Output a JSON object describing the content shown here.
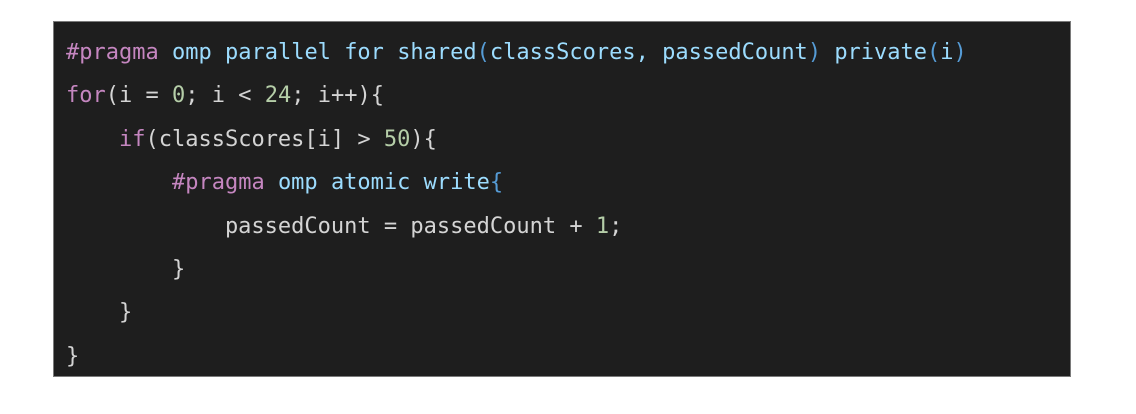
{
  "code": {
    "lines": [
      [
        {
          "t": "#pragma",
          "c": "dir"
        },
        {
          "t": " ",
          "c": "pl"
        },
        {
          "t": "omp",
          "c": "id"
        },
        {
          "t": " ",
          "c": "pl"
        },
        {
          "t": "parallel",
          "c": "id"
        },
        {
          "t": " ",
          "c": "pl"
        },
        {
          "t": "for",
          "c": "id"
        },
        {
          "t": " ",
          "c": "pl"
        },
        {
          "t": "shared",
          "c": "id"
        },
        {
          "t": "(",
          "c": "br"
        },
        {
          "t": "classScores, passedCount",
          "c": "id"
        },
        {
          "t": ")",
          "c": "br"
        },
        {
          "t": " ",
          "c": "pl"
        },
        {
          "t": "private",
          "c": "id"
        },
        {
          "t": "(",
          "c": "br"
        },
        {
          "t": "i",
          "c": "id"
        },
        {
          "t": ")",
          "c": "br"
        }
      ],
      [
        {
          "t": "for",
          "c": "kw"
        },
        {
          "t": "(i = ",
          "c": "pl"
        },
        {
          "t": "0",
          "c": "num"
        },
        {
          "t": "; i < ",
          "c": "pl"
        },
        {
          "t": "24",
          "c": "num"
        },
        {
          "t": "; i++){",
          "c": "pl"
        }
      ],
      [
        {
          "t": "    ",
          "c": "pl"
        },
        {
          "t": "if",
          "c": "kw"
        },
        {
          "t": "(classScores[i] > ",
          "c": "pl"
        },
        {
          "t": "50",
          "c": "num"
        },
        {
          "t": "){",
          "c": "pl"
        }
      ],
      [
        {
          "t": "        ",
          "c": "pl"
        },
        {
          "t": "#pragma",
          "c": "dir"
        },
        {
          "t": " ",
          "c": "pl"
        },
        {
          "t": "omp",
          "c": "id"
        },
        {
          "t": " ",
          "c": "pl"
        },
        {
          "t": "atomic",
          "c": "id"
        },
        {
          "t": " ",
          "c": "pl"
        },
        {
          "t": "write",
          "c": "id"
        },
        {
          "t": "{",
          "c": "br"
        }
      ],
      [
        {
          "t": "            passedCount = passedCount + ",
          "c": "pl"
        },
        {
          "t": "1",
          "c": "num"
        },
        {
          "t": ";",
          "c": "pl"
        }
      ],
      [
        {
          "t": "        }",
          "c": "pl"
        }
      ],
      [
        {
          "t": "    }",
          "c": "pl"
        }
      ],
      [
        {
          "t": "}",
          "c": "pl"
        }
      ]
    ]
  },
  "colors": {
    "background": "#1e1e1e",
    "directive": "#c586c0",
    "keyword": "#c586c0",
    "identifier": "#9cdcfe",
    "number": "#b5cea8",
    "bracket": "#569cd6",
    "plain": "#d4d4d4"
  }
}
